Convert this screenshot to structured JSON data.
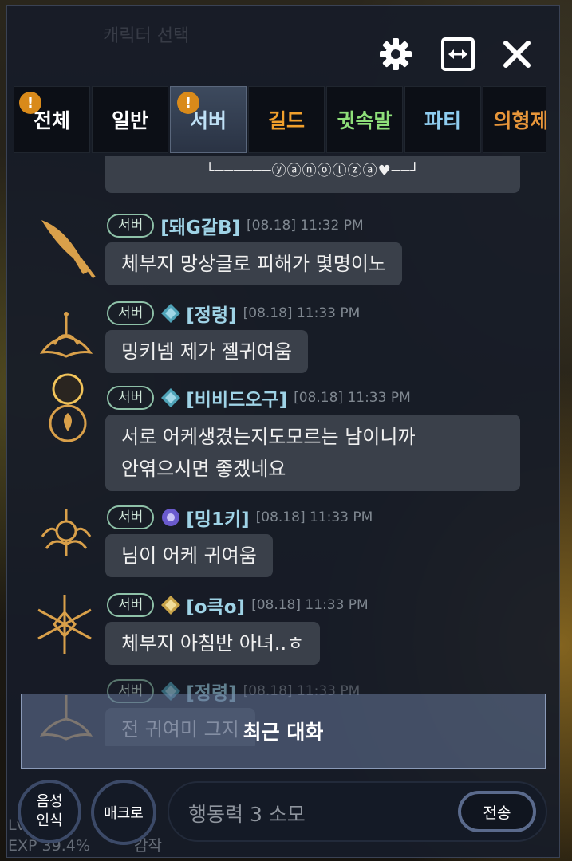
{
  "window": {
    "settings_icon": "gear-icon",
    "resize_icon": "expand-horizontal-icon",
    "close_icon": "close-icon",
    "bg_ghost_text": "캐릭터 선택"
  },
  "tabs": [
    {
      "label": "전체",
      "color": "#ffffff",
      "badge": "!",
      "active": false
    },
    {
      "label": "일반",
      "color": "#ffffff",
      "badge": "",
      "active": false
    },
    {
      "label": "서버",
      "color": "#bfe0f5",
      "badge": "!",
      "active": true
    },
    {
      "label": "길드",
      "color": "#f2a02c",
      "badge": "",
      "active": false
    },
    {
      "label": "귓속말",
      "color": "#8fe07a",
      "badge": "",
      "active": false
    },
    {
      "label": "파티",
      "color": "#8fcdf0",
      "badge": "",
      "active": false
    },
    {
      "label": "의형제",
      "color": "#e8963a",
      "badge": "",
      "active": false
    }
  ],
  "messages": [
    {
      "bubble": "└──────ⓨⓐⓝⓞⓛⓩⓐ♥──┘",
      "partial": true
    },
    {
      "channel": "서버",
      "name": "[돼G갈B]",
      "time": "[08.18] 11:32 PM",
      "text": "체부지 망상글로 피해가 몇명이노",
      "avatar": "feather"
    },
    {
      "channel": "서버",
      "name": "[정령]",
      "time": "[08.18] 11:33 PM",
      "text": "밍키넴 제가 젤귀여움",
      "avatar": "lotus"
    },
    {
      "channel": "서버",
      "name": "[비비드오구]",
      "time": "[08.18] 11:33 PM",
      "text": "서로 어케생겼는지도모르는 남이니까\n안엮으시면 좋겠네요",
      "avatar": "orb"
    },
    {
      "channel": "서버",
      "name": "[밍1키]",
      "time": "[08.18] 11:33 PM",
      "text": "님이 어케 귀여움",
      "avatar": "crest"
    },
    {
      "channel": "서버",
      "name": "[o큭o]",
      "time": "[08.18] 11:33 PM",
      "text": "체부지 아침반 아녀..ㅎ",
      "avatar": "star"
    },
    {
      "channel": "서버",
      "name": "[정령]",
      "time": "[08.18] 11:33 PM",
      "text": "전 귀여미 그지",
      "avatar": "lotus"
    }
  ],
  "recent_overlay": "최근 대화",
  "bottom": {
    "voice_label": "음성\n인식",
    "macro_label": "매크로",
    "input_placeholder": "행동력 3 소모",
    "send_label": "전송",
    "exp_text": "EXP 39.4%",
    "ghost_text": "Lv",
    "ghost_text2": "감작"
  },
  "colors": {
    "name": "#9fd3e6",
    "chip": "#8ec1a8",
    "badge": "#d98a1a"
  }
}
